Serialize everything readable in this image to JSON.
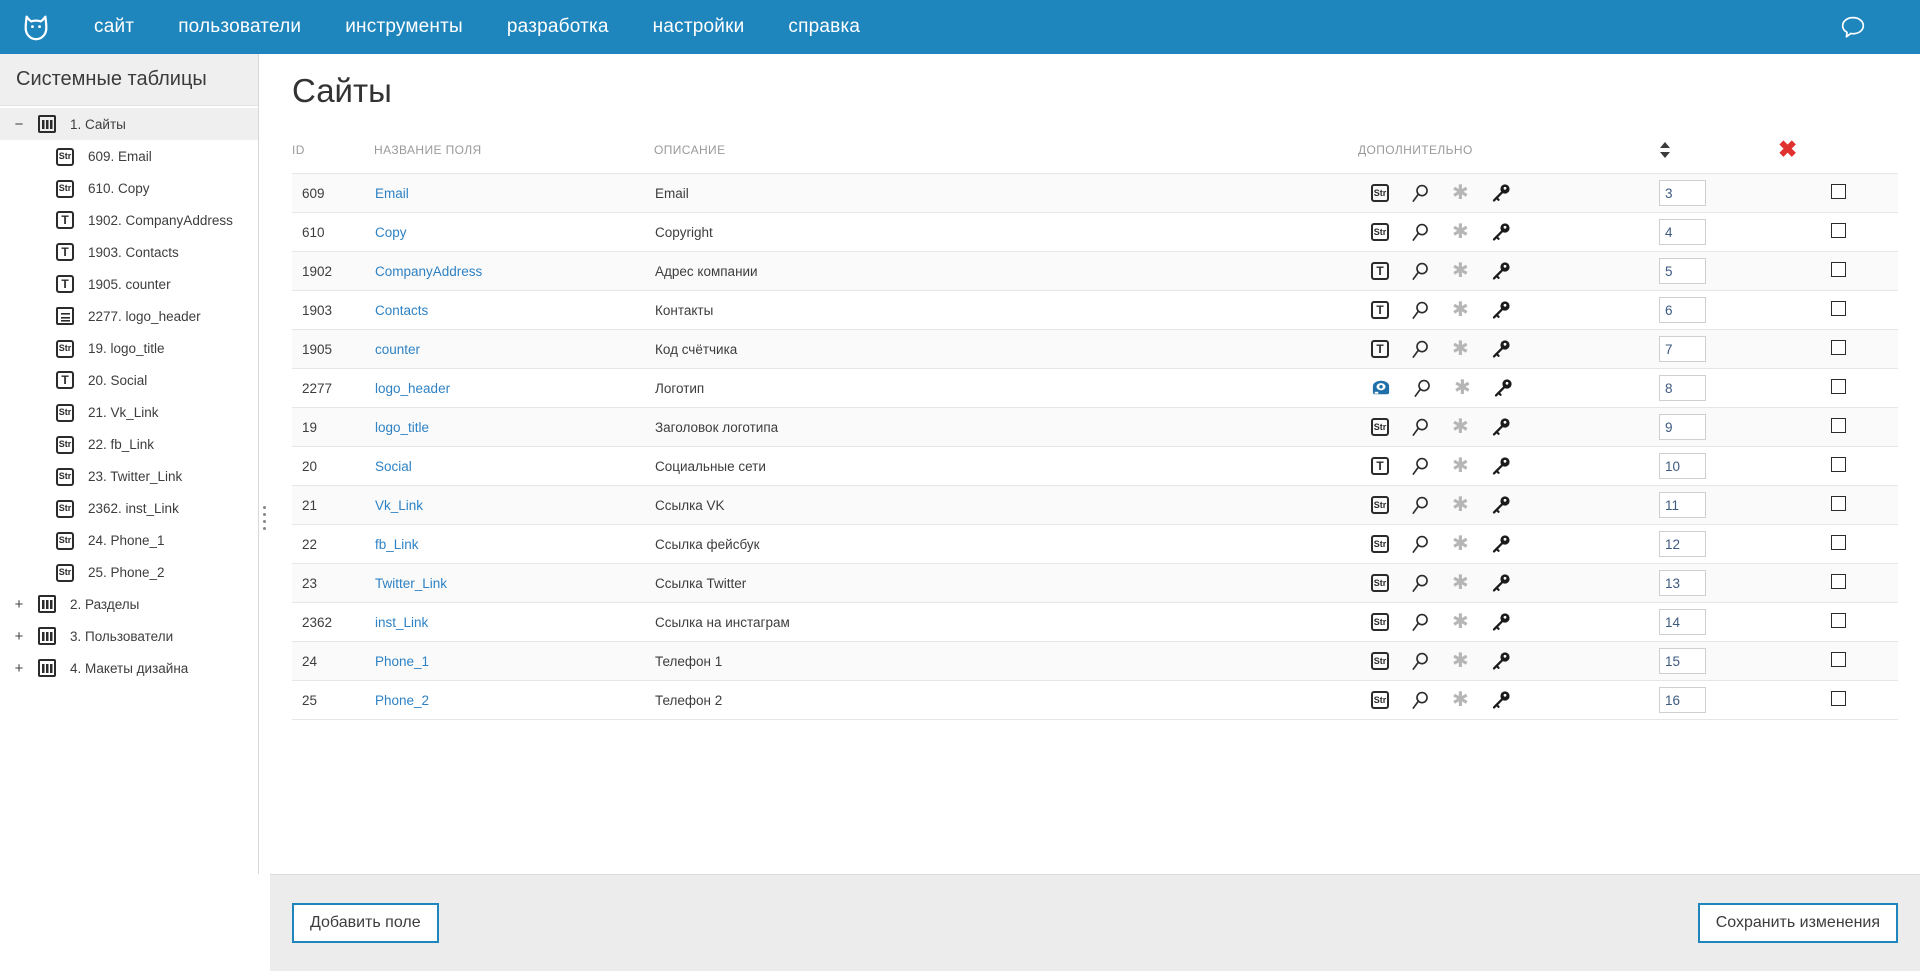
{
  "topnav": {
    "logo_icon": "owl-logo-icon",
    "links": [
      {
        "label": "сайт"
      },
      {
        "label": "пользователи"
      },
      {
        "label": "инструменты"
      },
      {
        "label": "разработка"
      },
      {
        "label": "настройки"
      },
      {
        "label": "справка"
      }
    ],
    "chat_icon": "chat-bubble-icon",
    "background_color": "#1f86bd"
  },
  "sidebar": {
    "title": "Системные таблицы",
    "tree": [
      {
        "toggle": "−",
        "icon": "table-icon",
        "label": "1. Сайты",
        "level": 0,
        "selected": true
      },
      {
        "icon": "str-badge-icon",
        "label": "609. Email",
        "level": 1
      },
      {
        "icon": "str-badge-icon",
        "label": "610. Copy",
        "level": 1
      },
      {
        "icon": "text-badge-icon",
        "label": "1902. CompanyAddress",
        "level": 1
      },
      {
        "icon": "text-badge-icon",
        "label": "1903. Contacts",
        "level": 1
      },
      {
        "icon": "text-badge-icon",
        "label": "1905. counter",
        "level": 1
      },
      {
        "icon": "document-badge-icon",
        "label": "2277. logo_header",
        "level": 1
      },
      {
        "icon": "str-badge-icon",
        "label": "19. logo_title",
        "level": 1
      },
      {
        "icon": "text-badge-icon",
        "label": "20. Social",
        "level": 1
      },
      {
        "icon": "str-badge-icon",
        "label": "21. Vk_Link",
        "level": 1
      },
      {
        "icon": "str-badge-icon",
        "label": "22. fb_Link",
        "level": 1
      },
      {
        "icon": "str-badge-icon",
        "label": "23. Twitter_Link",
        "level": 1
      },
      {
        "icon": "str-badge-icon",
        "label": "2362. inst_Link",
        "level": 1
      },
      {
        "icon": "str-badge-icon",
        "label": "24. Phone_1",
        "level": 1
      },
      {
        "icon": "str-badge-icon",
        "label": "25. Phone_2",
        "level": 1
      },
      {
        "toggle": "+",
        "icon": "table-icon",
        "label": "2. Разделы",
        "level": 0
      },
      {
        "toggle": "+",
        "icon": "table-icon",
        "label": "3. Пользователи",
        "level": 0
      },
      {
        "toggle": "+",
        "icon": "table-icon",
        "label": "4. Макеты дизайна",
        "level": 0
      }
    ]
  },
  "main": {
    "page_title": "Сайты",
    "table": {
      "headers": {
        "id": "ID",
        "name": "НАЗВАНИЕ ПОЛЯ",
        "description": "ОПИСАНИЕ",
        "extra": "ДОПОЛНИТЕЛЬНО",
        "sort_icon": "sort-arrows-icon",
        "delete_icon": "red-x-icon"
      },
      "rows": [
        {
          "id": "609",
          "name": "Email",
          "description": "Email",
          "type_icon": "str-badge-icon",
          "search_icon": "magnifier-icon",
          "star_icon": "star-icon",
          "key_icon": "key-icon",
          "order": "3",
          "checked": false
        },
        {
          "id": "610",
          "name": "Copy",
          "description": "Copyright",
          "type_icon": "str-badge-icon",
          "search_icon": "magnifier-icon",
          "star_icon": "star-icon",
          "key_icon": "key-icon",
          "order": "4",
          "checked": false
        },
        {
          "id": "1902",
          "name": "CompanyAddress",
          "description": "Адрес компании",
          "type_icon": "text-badge-icon",
          "search_icon": "magnifier-icon",
          "star_icon": "star-icon",
          "key_icon": "key-icon",
          "order": "5",
          "checked": false
        },
        {
          "id": "1903",
          "name": "Contacts",
          "description": "Контакты",
          "type_icon": "text-badge-icon",
          "search_icon": "magnifier-icon",
          "star_icon": "star-icon",
          "key_icon": "key-icon",
          "order": "6",
          "checked": false
        },
        {
          "id": "1905",
          "name": "counter",
          "description": "Код счётчика",
          "type_icon": "text-badge-icon",
          "search_icon": "magnifier-icon",
          "star_icon": "star-icon",
          "key_icon": "key-icon",
          "order": "7",
          "checked": false
        },
        {
          "id": "2277",
          "name": "logo_header",
          "description": "Логотип",
          "type_icon": "disk-blue-icon",
          "search_icon": "magnifier-icon",
          "star_icon": "star-icon",
          "key_icon": "key-icon",
          "order": "8",
          "checked": false
        },
        {
          "id": "19",
          "name": "logo_title",
          "description": "Заголовок логотипа",
          "type_icon": "str-badge-icon",
          "search_icon": "magnifier-icon",
          "star_icon": "star-icon",
          "key_icon": "key-icon",
          "order": "9",
          "checked": false
        },
        {
          "id": "20",
          "name": "Social",
          "description": "Социальные сети",
          "type_icon": "text-badge-icon",
          "search_icon": "magnifier-icon",
          "star_icon": "star-icon",
          "key_icon": "key-icon",
          "order": "10",
          "checked": false
        },
        {
          "id": "21",
          "name": "Vk_Link",
          "description": "Ссылка VK",
          "type_icon": "str-badge-icon",
          "search_icon": "magnifier-icon",
          "star_icon": "star-icon",
          "key_icon": "key-icon",
          "order": "11",
          "checked": false
        },
        {
          "id": "22",
          "name": "fb_Link",
          "description": "Ссылка фейсбук",
          "type_icon": "str-badge-icon",
          "search_icon": "magnifier-icon",
          "star_icon": "star-icon",
          "key_icon": "key-icon",
          "order": "12",
          "checked": false
        },
        {
          "id": "23",
          "name": "Twitter_Link",
          "description": "Ссылка Twitter",
          "type_icon": "str-badge-icon",
          "search_icon": "magnifier-icon",
          "star_icon": "star-icon",
          "key_icon": "key-icon",
          "order": "13",
          "checked": false
        },
        {
          "id": "2362",
          "name": "inst_Link",
          "description": "Ссылка на инстаграм",
          "type_icon": "str-badge-icon",
          "search_icon": "magnifier-icon",
          "star_icon": "star-icon",
          "key_icon": "key-icon",
          "order": "14",
          "checked": false
        },
        {
          "id": "24",
          "name": "Phone_1",
          "description": "Телефон 1",
          "type_icon": "str-badge-icon",
          "search_icon": "magnifier-icon",
          "star_icon": "star-icon",
          "key_icon": "key-icon",
          "order": "15",
          "checked": false
        },
        {
          "id": "25",
          "name": "Phone_2",
          "description": "Телефон 2",
          "type_icon": "str-badge-icon",
          "search_icon": "magnifier-icon",
          "star_icon": "star-icon",
          "key_icon": "key-icon",
          "order": "16",
          "checked": false
        }
      ]
    }
  },
  "footer": {
    "add_field_label": "Добавить поле",
    "save_changes_label": "Сохранить изменения"
  },
  "colors": {
    "brand_blue": "#1f86bd",
    "link_blue": "#2e82c4",
    "delete_red": "#e03131",
    "row_alt": "#fafafa",
    "sidebar_header": "#efefef",
    "footer_bg": "#ececec"
  }
}
